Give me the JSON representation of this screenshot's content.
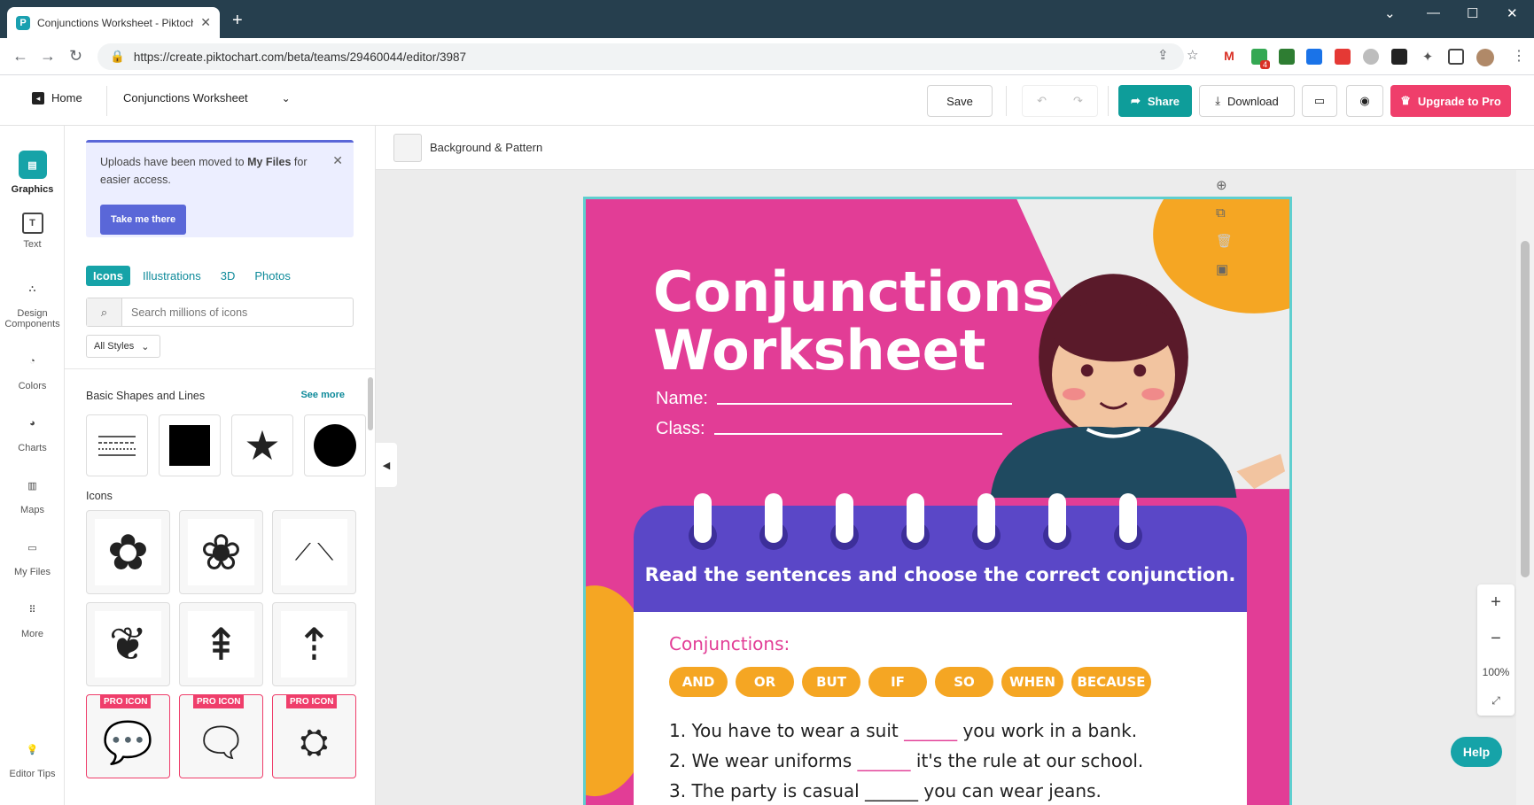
{
  "browser": {
    "tab_title": "Conjunctions Worksheet - Piktochart",
    "tab_icon": "piktochart-logo-icon",
    "new_tab": "+",
    "url": "https://create.piktochart.com/beta/teams/29460044/editor/3987",
    "extension_badge": "4"
  },
  "header": {
    "home_label": "Home",
    "doc_title": "Conjunctions Worksheet",
    "save_label": "Save",
    "share_label": "Share",
    "download_label": "Download",
    "upgrade_label": "Upgrade to Pro"
  },
  "rail": [
    {
      "label": "Graphics",
      "icon": "graphics-icon"
    },
    {
      "label": "Text",
      "icon": "text-icon"
    },
    {
      "label": "Design Components",
      "icon": "design-components-icon"
    },
    {
      "label": "Colors",
      "icon": "palette-icon"
    },
    {
      "label": "Charts",
      "icon": "pie-chart-icon"
    },
    {
      "label": "Maps",
      "icon": "map-icon"
    },
    {
      "label": "My Files",
      "icon": "folder-icon"
    },
    {
      "label": "More",
      "icon": "grid-icon"
    },
    {
      "label": "Editor Tips",
      "icon": "lightbulb-icon"
    }
  ],
  "panel": {
    "notice_text_1": "Uploads have been moved to ",
    "notice_bold": "My Files",
    "notice_text_2": " for easier access.",
    "notice_button": "Take me there",
    "tabs": [
      "Icons",
      "Illustrations",
      "3D",
      "Photos"
    ],
    "search_placeholder": "Search millions of icons",
    "styles_label": "All Styles",
    "shapes_heading": "Basic Shapes and Lines",
    "see_more": "See more",
    "icons_heading": "Icons",
    "pro_badge": "PRO ICON"
  },
  "canvas": {
    "background_label": "Background & Pattern",
    "zoom_level": "100%",
    "help_label": "Help"
  },
  "worksheet": {
    "title_line1": "Conjunctions",
    "title_line2": "Worksheet",
    "name_label": "Name:",
    "class_label": "Class:",
    "instruction": "Read the sentences and choose the correct conjunction.",
    "conjunctions_label": "Conjunctions:",
    "conjunctions": [
      "AND",
      "OR",
      "BUT",
      "IF",
      "SO",
      "WHEN",
      "BECAUSE"
    ],
    "sentence1_a": "1. You have to wear a suit ",
    "sentence1_blank": "______",
    "sentence1_b": " you work in a bank.",
    "sentence2_a": "2. We wear uniforms ",
    "sentence2_blank": "______",
    "sentence2_b": " it's the rule at our school.",
    "sentence3_partial": "3. The party is casual ______ you can wear jeans."
  },
  "colors": {
    "brand_teal": "#16a3a8",
    "upgrade_pink": "#ef3e6b",
    "sheet_pink": "#e23d96",
    "notebook_purple": "#5a47c7",
    "pill_orange": "#f5a623"
  }
}
